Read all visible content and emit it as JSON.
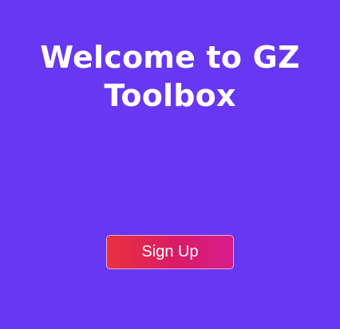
{
  "welcome": {
    "title": "Welcome to GZ Toolbox",
    "signup_label": "Sign Up"
  }
}
